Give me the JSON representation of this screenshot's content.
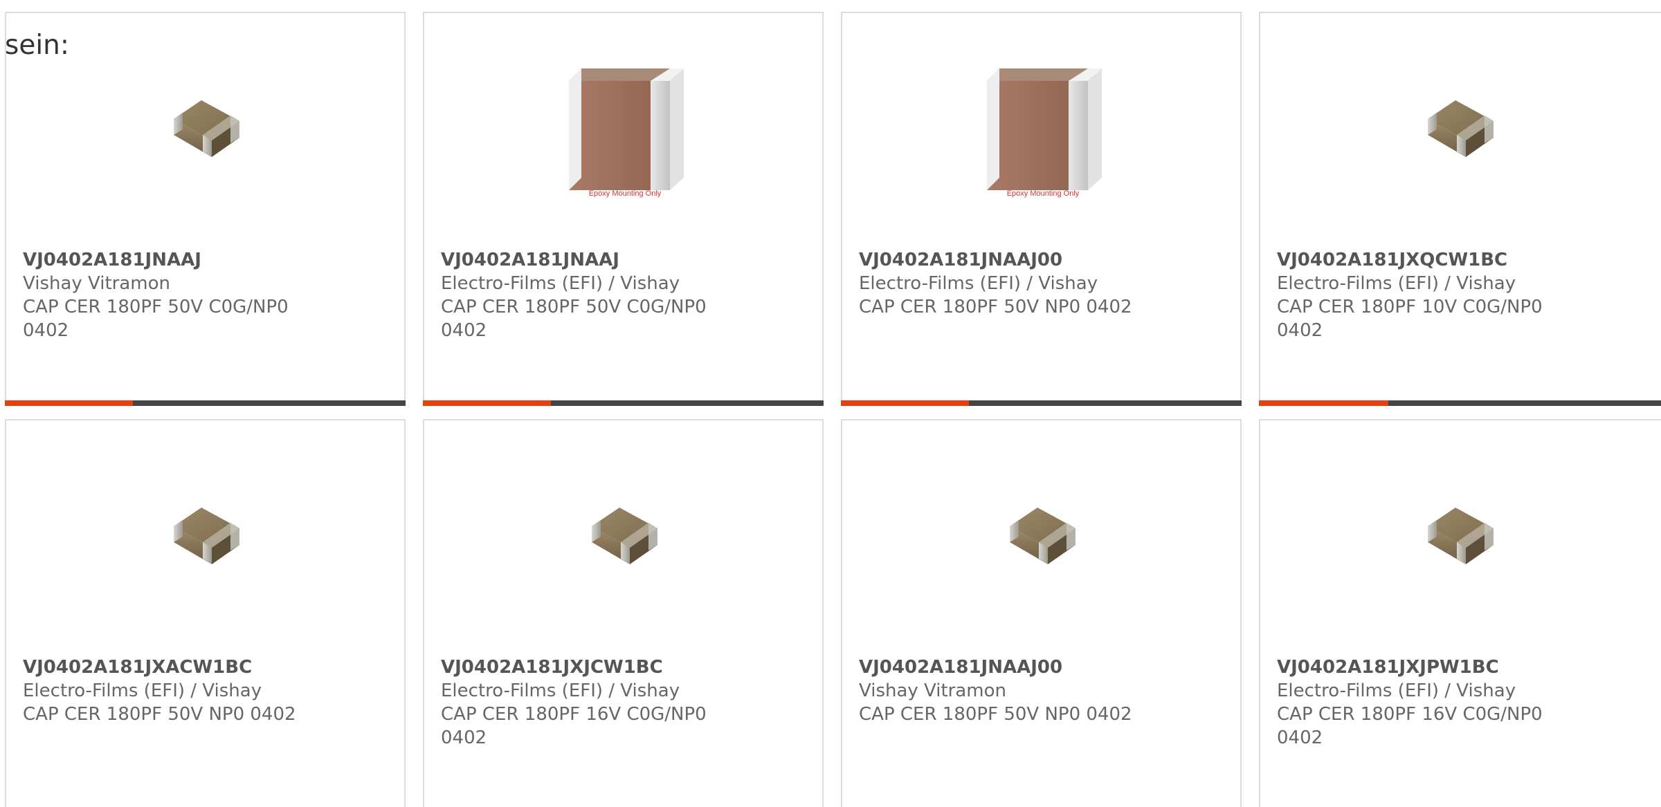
{
  "intro_text": "sein:",
  "colors": {
    "accent": "#e8400c",
    "bar_track": "#444444",
    "border": "#dcdcdc",
    "text": "#666666"
  },
  "cards": [
    {
      "part_number": "VJ0402A181JNAAJ",
      "manufacturer": "Vishay Vitramon",
      "description": "CAP CER 180PF 50V C0G/NP0 0402",
      "image": "chip-capacitor-small",
      "progress": 0.32
    },
    {
      "part_number": "VJ0402A181JNAAJ",
      "manufacturer": "Electro-Films (EFI) / Vishay",
      "description": "CAP CER 180PF 50V C0G/NP0 0402",
      "image": "chip-capacitor-epoxy",
      "image_caption": "Epoxy Mounting Only",
      "progress": 0.32
    },
    {
      "part_number": "VJ0402A181JNAAJ00",
      "manufacturer": "Electro-Films (EFI) / Vishay",
      "description": "CAP CER 180PF 50V NP0 0402",
      "image": "chip-capacitor-epoxy",
      "image_caption": "Epoxy Mounting Only",
      "progress": 0.32
    },
    {
      "part_number": "VJ0402A181JXQCW1BC",
      "manufacturer": "Electro-Films (EFI) / Vishay",
      "description": "CAP CER 180PF 10V C0G/NP0 0402",
      "image": "chip-capacitor-small",
      "progress": 0.32
    },
    {
      "part_number": "VJ0402A181JXACW1BC",
      "manufacturer": "Electro-Films (EFI) / Vishay",
      "description": "CAP CER 180PF 50V NP0 0402",
      "image": "chip-capacitor-small"
    },
    {
      "part_number": "VJ0402A181JXJCW1BC",
      "manufacturer": "Electro-Films (EFI) / Vishay",
      "description": "CAP CER 180PF 16V C0G/NP0 0402",
      "image": "chip-capacitor-small"
    },
    {
      "part_number": "VJ0402A181JNAAJ00",
      "manufacturer": "Vishay Vitramon",
      "description": "CAP CER 180PF 50V NP0 0402",
      "image": "chip-capacitor-small"
    },
    {
      "part_number": "VJ0402A181JXJPW1BC",
      "manufacturer": "Electro-Films (EFI) / Vishay",
      "description": "CAP CER 180PF 16V C0G/NP0 0402",
      "image": "chip-capacitor-small"
    }
  ]
}
